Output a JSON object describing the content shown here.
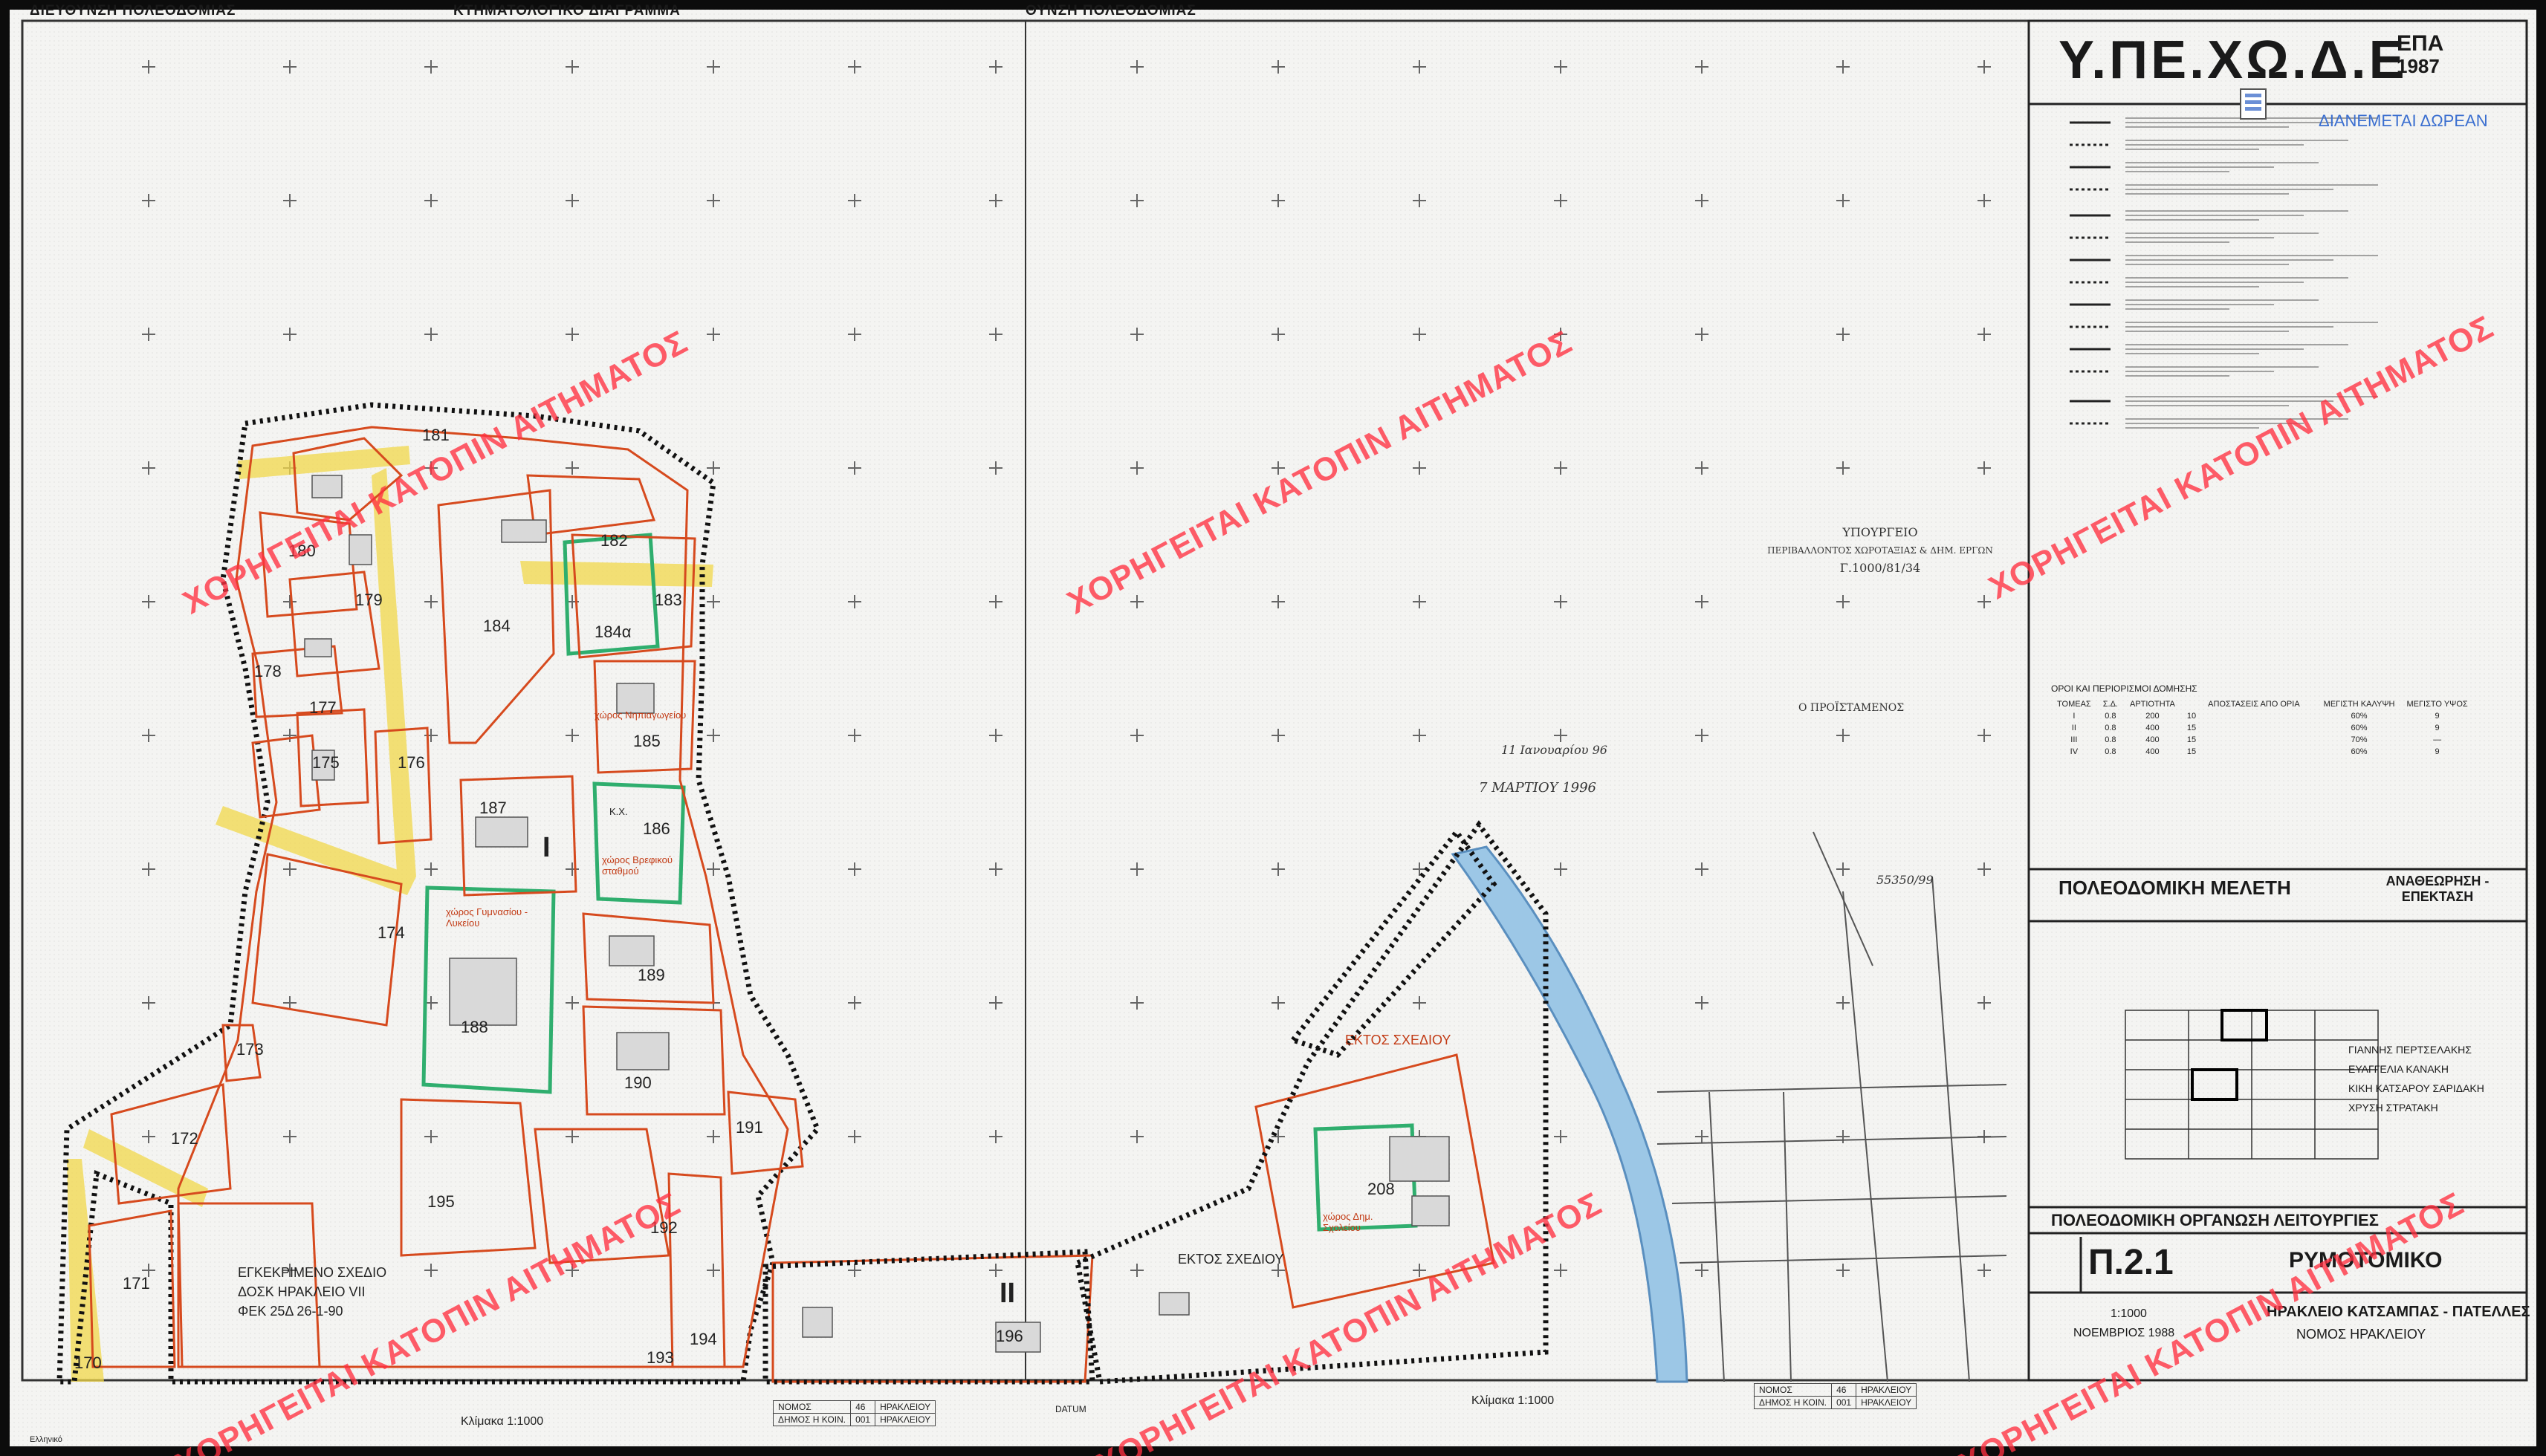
{
  "header": {
    "left": "ΔΙΕΥΘΥΝΣΗ ΠΟΛΕΟΔΟΜΙΑΣ",
    "center": "ΚΤΗΜΑΤΟΛΟΓΙΚΟ ΔΙΑΓΡΑΜΜΑ",
    "right": "ΘΥΝΣΗ ΠΟΛΕΟΔΟΜΙΑΣ"
  },
  "title_block": {
    "agency": "Υ.ΠΕ.ΧΩ.Δ.Ε",
    "program": "ΕΠΑ",
    "year": "1987",
    "free_label": "ΔΙΑΝΕΜΕΤΑΙ ΔΩΡΕΑΝ",
    "study_title": "ΠΟΛΕΟΔΟΜΙΚΗ ΜΕΛΕΤΗ",
    "study_subtitle": "ΑΝΑΘΕΩΡΗΣΗ - ΕΠΕΚΤΑΣΗ",
    "consultants": [
      "ΓΙΑΝΝΗΣ ΠΕΡΤΣΕΛΑΚΗΣ",
      "ΕΥΑΓΓΕΛΙΑ ΚΑΝΑΚΗ",
      "ΚΙΚΗ ΚΑΤΣΑΡΟΥ ΣΑΡΙΔΑΚΗ",
      "ΧΡΥΣΗ ΣΤΡΑΤΑΚΗ"
    ],
    "organisation": "ΠΟΛΕΟΔΟΜΙΚΗ ΟΡΓΑΝΩΣΗ ΛΕΙΤΟΥΡΓΙΕΣ",
    "sheet_number": "Π.2.1",
    "sheet_title": "ΡΥΜΟΤΟΜΙΚΟ",
    "scale_label": "1:1000",
    "location": "ΗΡΑΚΛΕΙΟ ΚΑΤΣΑΜΠΑΣ - ΠΑΤΕΛΛΕΣ",
    "date": "ΝΟΕΜΒΡΙΟΣ 1988",
    "prefecture": "ΝΟΜΟΣ ΗΡΑΚΛΕΙΟΥ"
  },
  "regulations": {
    "title": "ΟΡΟΙ ΚΑΙ ΠΕΡΙΟΡΙΣΜΟΙ ΔΟΜΗΣΗΣ",
    "headers": [
      "ΤΟΜΕΑΣ",
      "Σ.Δ.",
      "ΑΡΤΙΟΤΗΤΑ",
      "",
      "ΑΠΟΣΤΑΣΕΙΣ ΑΠΟ ΟΡΙΑ",
      "",
      "ΜΕΓΙΣΤΗ ΚΑΛΥΨΗ",
      "ΜΕΓΙΣΤΟ ΥΨΟΣ"
    ],
    "rows": [
      [
        "I",
        "0.8",
        "200",
        "10",
        "",
        "",
        "60%",
        "9"
      ],
      [
        "II",
        "0.8",
        "400",
        "15",
        "",
        "",
        "60%",
        "9"
      ],
      [
        "III",
        "0.8",
        "400",
        "15",
        "",
        "",
        "70%",
        "—"
      ],
      [
        "IV",
        "0.8",
        "400",
        "15",
        "",
        "",
        "60%",
        "9"
      ]
    ]
  },
  "map": {
    "district_labels": [
      "I",
      "II"
    ],
    "lot_numbers": [
      "181",
      "180",
      "182",
      "179",
      "184",
      "184α",
      "183",
      "178",
      "177",
      "185",
      "175",
      "176",
      "187",
      "186",
      "174",
      "188",
      "189",
      "173",
      "190",
      "172",
      "191",
      "195",
      "192",
      "171",
      "193",
      "194",
      "196",
      "170",
      "208"
    ],
    "approved_plan": [
      "ΕΓΚΕΚΡΙΜΕΝΟ ΣΧΕΔΙΟ",
      "ΔΟΣΚ ΗΡΑΚΛΕΙΟ VII",
      "ΦΕΚ 25Δ 26-1-90"
    ],
    "outside_plan": "ΕΚΤΟΣ ΣΧΕΔΙΟΥ",
    "facility_labels": [
      "χώρος Νηπιαγωγείου",
      "χώρος Βρεφικού σταθμού",
      "χώρος Γυμνασίου - Λυκείου",
      "χώρος Δημ. Σχολείου",
      "Κ.Χ."
    ],
    "stamp": [
      "ΥΠΟΥΡΓΕΙΟ",
      "ΠΕΡΙΒΑΛΛΟΝΤΟΣ ΧΩΡΟΤΑΞΙΑΣ & ΔΗΜ. ΕΡΓΩΝ",
      "Γ.1000/81/34",
      "Ο ΠΡΟΪΣΤΑΜΕΝΟΣ"
    ],
    "handwritten": [
      "11 Ιανουαρίου 96",
      "7 ΜΑΡΤΙΟΥ 1996",
      "55350/99"
    ],
    "footer_scale": "Κλίμακα 1:1000",
    "footer_note": "Ελληνικό",
    "datum": "DATUM",
    "footer_table": {
      "rows": [
        [
          "ΝΟΜΟΣ",
          "46",
          "ΗΡΑΚΛΕΙΟΥ"
        ],
        [
          "ΔΗΜΟΣ Η ΚΟΙΝ.",
          "001",
          "ΗΡΑΚΛΕΙΟΥ"
        ]
      ]
    }
  },
  "watermark": "ΧΟΡΗΓΕΙΤΑΙ ΚΑΤΟΠΙΝ ΑΙΤΗΜΑΤΟΣ",
  "colors": {
    "parcel_line": "#d64a1e",
    "green_space": "#2fae6e",
    "street_yellow": "#f2d84a",
    "river": "#9cc7e6",
    "watermark": "#ff3040"
  }
}
